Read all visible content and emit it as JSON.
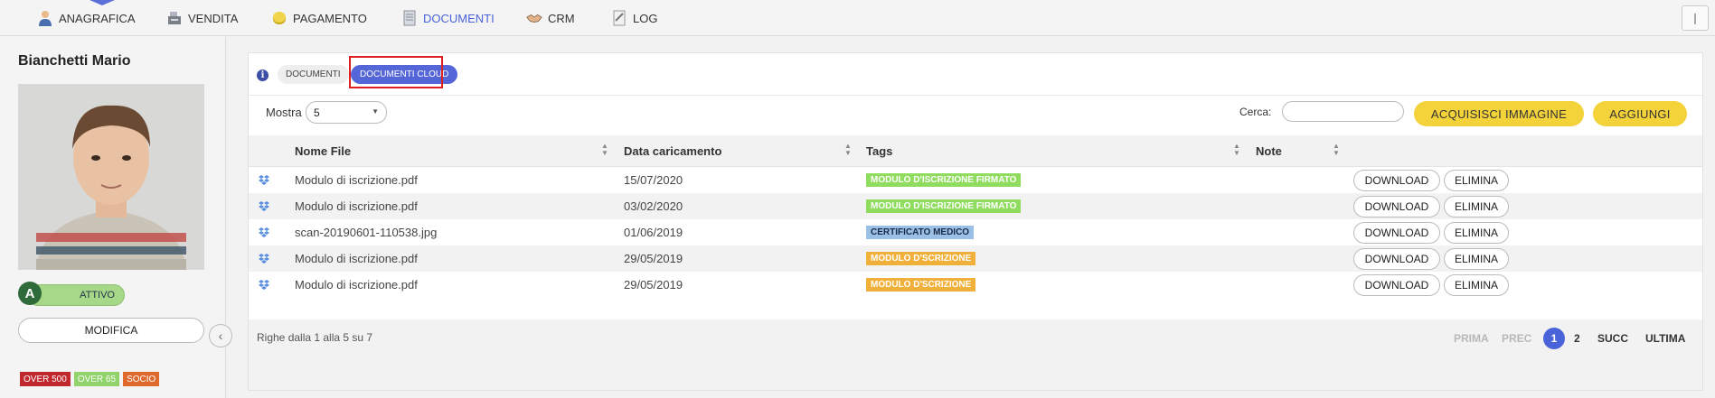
{
  "nav": {
    "items": [
      {
        "label": "ANAGRAFICA",
        "icon": "person-icon"
      },
      {
        "label": "VENDITA",
        "icon": "cash-register-icon"
      },
      {
        "label": "PAGAMENTO",
        "icon": "coin-icon"
      },
      {
        "label": "DOCUMENTI",
        "icon": "document-icon"
      },
      {
        "label": "CRM",
        "icon": "handshake-icon"
      },
      {
        "label": "LOG",
        "icon": "log-icon"
      }
    ],
    "pin_icon": "pin-icon"
  },
  "sidebar": {
    "name": "Bianchetti Mario",
    "status_letter": "A",
    "status_label": "ATTIVO",
    "modify_label": "MODIFICA",
    "badges": [
      {
        "label": "OVER 500",
        "color": "#c0282d"
      },
      {
        "label": "OVER 65",
        "color": "#8fd36a"
      },
      {
        "label": "SOCIO",
        "color": "#e06a2c"
      }
    ]
  },
  "tabs": {
    "documenti": "DOCUMENTI",
    "cloud": "DOCUMENTI CLOUD"
  },
  "controls": {
    "show_label": "Mostra",
    "show_value": "5",
    "search_label": "Cerca:",
    "search_value": "",
    "acquire_label": "ACQUISISCI IMMAGINE",
    "add_label": "AGGIUNGI"
  },
  "table": {
    "columns": [
      "Nome File",
      "Data caricamento",
      "Tags",
      "Note"
    ],
    "download_label": "DOWNLOAD",
    "delete_label": "ELIMINA",
    "rows": [
      {
        "file": "Modulo di iscrizione.pdf",
        "date": "15/07/2020",
        "tag": "MODULO D'ISCRIZIONE FIRMATO",
        "tag_color": "#8fdc5e",
        "tag_text": "#ffffff",
        "note": ""
      },
      {
        "file": "Modulo di iscrizione.pdf",
        "date": "03/02/2020",
        "tag": "MODULO D'ISCRIZIONE FIRMATO",
        "tag_color": "#8fdc5e",
        "tag_text": "#ffffff",
        "note": ""
      },
      {
        "file": "scan-20190601-110538.jpg",
        "date": "01/06/2019",
        "tag": "CERTIFICATO MEDICO",
        "tag_color": "#9ac0e8",
        "tag_text": "#1a2a44",
        "note": ""
      },
      {
        "file": "Modulo di iscrizione.pdf",
        "date": "29/05/2019",
        "tag": "MODULO D'SCRIZIONE",
        "tag_color": "#f0b03a",
        "tag_text": "#ffffff",
        "note": ""
      },
      {
        "file": "Modulo di iscrizione.pdf",
        "date": "29/05/2019",
        "tag": "MODULO D'SCRIZIONE",
        "tag_color": "#f0b03a",
        "tag_text": "#ffffff",
        "note": ""
      }
    ]
  },
  "footer": {
    "info": "Righe dalla 1 alla 5 su 7",
    "first": "PRIMA",
    "prev": "PREC",
    "pages": [
      "1",
      "2"
    ],
    "next": "SUCC",
    "last": "ULTIMA"
  }
}
